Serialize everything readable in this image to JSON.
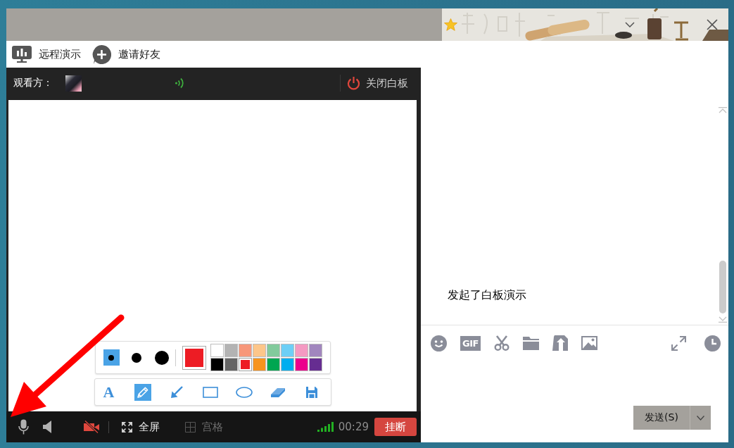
{
  "toolbar": {
    "items": [
      {
        "label": "远程演示"
      },
      {
        "label": "邀请好友"
      }
    ]
  },
  "whiteboard": {
    "viewer_label": "观看方：",
    "close_button": "关闭白板",
    "pen_sizes": [
      {
        "selected": true
      },
      {
        "selected": false
      },
      {
        "selected": false
      }
    ],
    "palette": [
      {
        "color": "#ffffff",
        "selected": false
      },
      {
        "color": "#b3b3b3",
        "selected": false
      },
      {
        "color": "#f7977a",
        "selected": false
      },
      {
        "color": "#fdc68a",
        "selected": false
      },
      {
        "color": "#82ca9c",
        "selected": false
      },
      {
        "color": "#6dcff6",
        "selected": false
      },
      {
        "color": "#f49ac2",
        "selected": false
      },
      {
        "color": "#a186be",
        "selected": false
      },
      {
        "color": "#000000",
        "selected": false
      },
      {
        "color": "#656565",
        "selected": false
      },
      {
        "color": "#ed1c24",
        "selected": true
      },
      {
        "color": "#f7941d",
        "selected": false
      },
      {
        "color": "#00a651",
        "selected": false
      },
      {
        "color": "#00aeef",
        "selected": false
      },
      {
        "color": "#ec008c",
        "selected": false
      },
      {
        "color": "#662d91",
        "selected": false
      }
    ],
    "tools": [
      {
        "kind": "text",
        "glyph": "A",
        "selected": false
      },
      {
        "kind": "pencil",
        "selected": true
      },
      {
        "kind": "arrow",
        "selected": false
      },
      {
        "kind": "rectangle",
        "selected": false
      },
      {
        "kind": "ellipse",
        "selected": false
      },
      {
        "kind": "eraser",
        "selected": false
      },
      {
        "kind": "save",
        "selected": false
      }
    ]
  },
  "call_bar": {
    "camera_on": false,
    "fullscreen_button": "全屏",
    "grid_button": {
      "label": "宫格",
      "disabled": true
    },
    "timer": "00:29",
    "hang_up_button": "挂断"
  },
  "chat": {
    "messages": [
      {
        "text": "发起了白板演示"
      }
    ],
    "toolbar": {
      "gif_button": "GIF"
    },
    "send_button": "发送(S)"
  }
}
